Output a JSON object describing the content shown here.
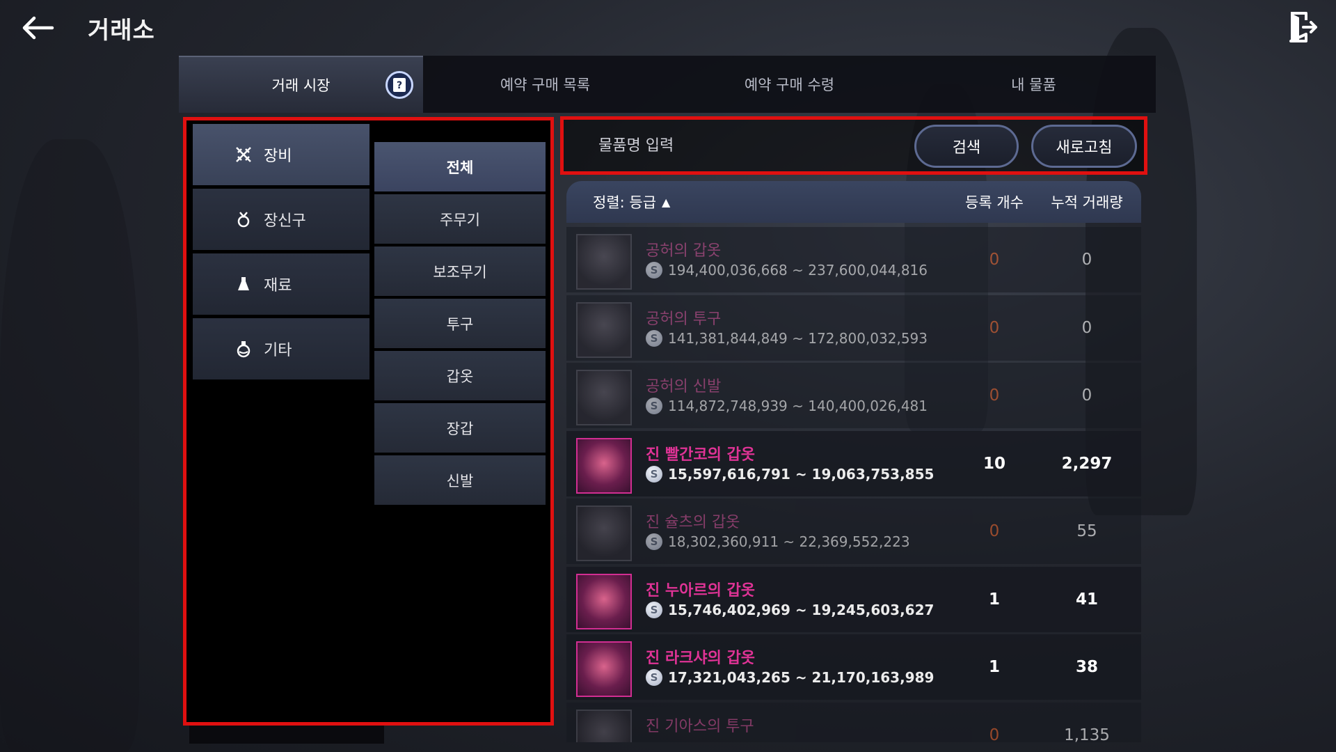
{
  "header": {
    "title": "거래소"
  },
  "tabs": [
    {
      "label": "거래 시장",
      "active": true
    },
    {
      "label": "예약 구매 목록",
      "active": false
    },
    {
      "label": "예약 구매 수령",
      "active": false
    },
    {
      "label": "내 물품",
      "active": false
    }
  ],
  "categories": [
    {
      "label": "장비",
      "icon": "crossed-swords-icon",
      "active": true
    },
    {
      "label": "장신구",
      "icon": "medal-icon",
      "active": false
    },
    {
      "label": "재료",
      "icon": "flask-icon",
      "active": false
    },
    {
      "label": "기타",
      "icon": "potion-icon",
      "active": false
    }
  ],
  "subcategories": [
    {
      "label": "전체",
      "active": true
    },
    {
      "label": "주무기",
      "active": false
    },
    {
      "label": "보조무기",
      "active": false
    },
    {
      "label": "투구",
      "active": false
    },
    {
      "label": "갑옷",
      "active": false
    },
    {
      "label": "장갑",
      "active": false
    },
    {
      "label": "신발",
      "active": false
    }
  ],
  "search": {
    "placeholder": "물품명 입력",
    "value": "",
    "search_label": "검색",
    "refresh_label": "새로고침"
  },
  "list_header": {
    "sort_label": "정렬: 등급",
    "sort_direction": "▲",
    "count_label": "등록 개수",
    "volume_label": "누적 거래량"
  },
  "items": [
    {
      "name": "공허의 갑옷",
      "price": "194,400,036,668 ~ 237,600,044,816",
      "count": "0",
      "volume": "0",
      "dim": true
    },
    {
      "name": "공허의 투구",
      "price": "141,381,844,849 ~ 172,800,032,593",
      "count": "0",
      "volume": "0",
      "dim": true
    },
    {
      "name": "공허의 신발",
      "price": "114,872,748,939 ~ 140,400,026,481",
      "count": "0",
      "volume": "0",
      "dim": true
    },
    {
      "name": "진 빨간코의 갑옷",
      "price": "15,597,616,791 ~ 19,063,753,855",
      "count": "10",
      "volume": "2,297",
      "dim": false
    },
    {
      "name": "진 슐츠의 갑옷",
      "price": "18,302,360,911 ~ 22,369,552,223",
      "count": "0",
      "volume": "55",
      "dim": true
    },
    {
      "name": "진 누아르의 갑옷",
      "price": "15,746,402,969 ~ 19,245,603,627",
      "count": "1",
      "volume": "41",
      "dim": false
    },
    {
      "name": "진 라크샤의 갑옷",
      "price": "17,321,043,265 ~ 21,170,163,989",
      "count": "1",
      "volume": "38",
      "dim": false
    },
    {
      "name": "진 기아스의 투구",
      "price": "",
      "count": "0",
      "volume": "1,135",
      "dim": true
    }
  ],
  "colors": {
    "highlight_border": "#e01010",
    "item_name": "#e03396",
    "zero_count": "#e0602b",
    "header_bar": "#3a4560"
  }
}
